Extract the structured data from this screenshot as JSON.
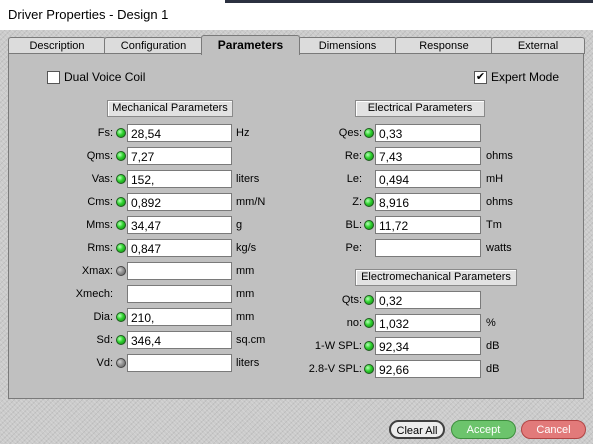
{
  "window": {
    "title": "Driver Properties - Design 1"
  },
  "tabs": [
    {
      "label": "Description"
    },
    {
      "label": "Configuration"
    },
    {
      "label": "Parameters"
    },
    {
      "label": "Dimensions"
    },
    {
      "label": "Response"
    },
    {
      "label": "External"
    }
  ],
  "active_tab": "Parameters",
  "options": {
    "dual_voice_coil": {
      "label": "Dual Voice Coil",
      "checked": false
    },
    "expert_mode": {
      "label": "Expert Mode",
      "checked": true,
      "mark": "✔"
    }
  },
  "mechanical": {
    "heading": "Mechanical Parameters",
    "rows": [
      {
        "label": "Fs:",
        "value": "28,54",
        "unit": "Hz",
        "led": "green"
      },
      {
        "label": "Qms:",
        "value": "7,27",
        "unit": "",
        "led": "green"
      },
      {
        "label": "Vas:",
        "value": "152,",
        "unit": "liters",
        "led": "green"
      },
      {
        "label": "Cms:",
        "value": "0,892",
        "unit": "mm/N",
        "led": "green"
      },
      {
        "label": "Mms:",
        "value": "34,47",
        "unit": "g",
        "led": "green"
      },
      {
        "label": "Rms:",
        "value": "0,847",
        "unit": "kg/s",
        "led": "green"
      },
      {
        "label": "Xmax:",
        "value": "",
        "unit": "mm",
        "led": "gray"
      },
      {
        "label": "Xmech:",
        "value": "",
        "unit": "mm",
        "led": "none"
      },
      {
        "label": "Dia:",
        "value": "210,",
        "unit": "mm",
        "led": "green"
      },
      {
        "label": "Sd:",
        "value": "346,4",
        "unit": "sq.cm",
        "led": "green"
      },
      {
        "label": "Vd:",
        "value": "",
        "unit": "liters",
        "led": "gray"
      }
    ]
  },
  "electrical": {
    "heading": "Electrical Parameters",
    "rows": [
      {
        "label": "Qes:",
        "value": "0,33",
        "unit": "",
        "led": "green"
      },
      {
        "label": "Re:",
        "value": "7,43",
        "unit": "ohms",
        "led": "green"
      },
      {
        "label": "Le:",
        "value": "0,494",
        "unit": "mH",
        "led": "none"
      },
      {
        "label": "Z:",
        "value": "8,916",
        "unit": "ohms",
        "led": "green"
      },
      {
        "label": "BL:",
        "value": "11,72",
        "unit": "Tm",
        "led": "green"
      },
      {
        "label": "Pe:",
        "value": "",
        "unit": "watts",
        "led": "none"
      }
    ]
  },
  "electromechanical": {
    "heading": "Electromechanical Parameters",
    "rows": [
      {
        "label": "Qts:",
        "value": "0,32",
        "unit": "",
        "led": "green"
      },
      {
        "label": "no:",
        "value": "1,032",
        "unit": "%",
        "led": "green"
      },
      {
        "label": "1-W SPL:",
        "value": "92,34",
        "unit": "dB",
        "led": "green"
      },
      {
        "label": "2.8-V SPL:",
        "value": "92,66",
        "unit": "dB",
        "led": "green"
      }
    ]
  },
  "buttons": {
    "clear_all": "Clear All",
    "accept": "Accept",
    "cancel": "Cancel"
  }
}
